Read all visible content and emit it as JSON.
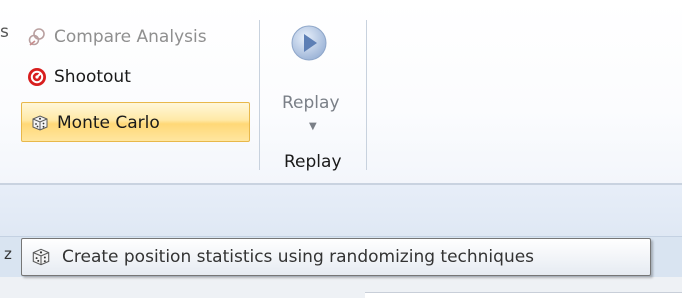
{
  "ribbon": {
    "left_cut_text": "s",
    "commands": [
      {
        "label": "Compare Analysis",
        "icon": "compare-analysis-icon",
        "state": "disabled"
      },
      {
        "label": "Shootout",
        "icon": "shootout-icon",
        "state": "normal"
      },
      {
        "label": "Monte Carlo",
        "icon": "dice-icon",
        "state": "hovered"
      }
    ],
    "replay": {
      "button_label": "Replay",
      "icon": "play-circle-icon",
      "group_label": "Replay"
    }
  },
  "status": {
    "left_cut_text": "z"
  },
  "tooltip": {
    "text": "Create position statistics using randomizing techniques",
    "icon": "dice-icon"
  },
  "colors": {
    "hover_fill": "#ffe08a",
    "hover_border": "#e8b84a",
    "shootout_red": "#d81e1e",
    "replay_blue": "#5d7fb5"
  }
}
